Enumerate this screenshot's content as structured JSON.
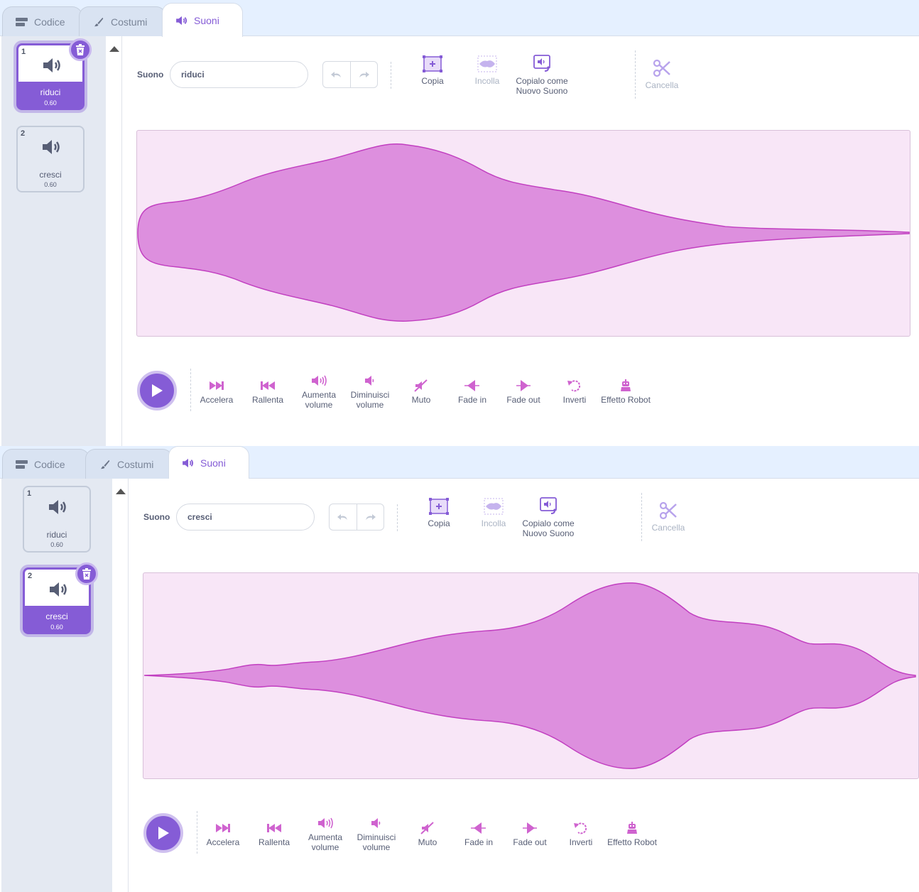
{
  "editors": [
    {
      "tabs": {
        "code": "Codice",
        "costumes": "Costumi",
        "sounds": "Suoni"
      },
      "sound_label": "Suono",
      "sound_name": "riduci",
      "toolbar": {
        "copy": "Copia",
        "paste": "Incolla",
        "copy_new": "Copialo come Nuovo Suono",
        "delete": "Cancella"
      },
      "sounds": [
        {
          "number": "1",
          "name": "riduci",
          "duration": "0.60",
          "selected": true
        },
        {
          "number": "2",
          "name": "cresci",
          "duration": "0.60",
          "selected": false
        }
      ],
      "effects": {
        "faster": "Accelera",
        "slower": "Rallenta",
        "louder": "Aumenta volume",
        "softer": "Diminuisci volume",
        "mute": "Muto",
        "fade_in": "Fade in",
        "fade_out": "Fade out",
        "reverse": "Inverti",
        "robot": "Effetto Robot"
      }
    },
    {
      "tabs": {
        "code": "Codice",
        "costumes": "Costumi",
        "sounds": "Suoni"
      },
      "sound_label": "Suono",
      "sound_name": "cresci",
      "toolbar": {
        "copy": "Copia",
        "paste": "Incolla",
        "copy_new": "Copialo come Nuovo Suono",
        "delete": "Cancella"
      },
      "sounds": [
        {
          "number": "1",
          "name": "riduci",
          "duration": "0.60",
          "selected": false
        },
        {
          "number": "2",
          "name": "cresci",
          "duration": "0.60",
          "selected": true
        }
      ],
      "effects": {
        "faster": "Accelera",
        "slower": "Rallenta",
        "louder": "Aumenta volume",
        "softer": "Diminuisci volume",
        "mute": "Muto",
        "fade_in": "Fade in",
        "fade_out": "Fade out",
        "reverse": "Inverti",
        "robot": "Effetto Robot"
      }
    }
  ],
  "colors": {
    "accent": "#855cd6",
    "waveform_fill": "#dd8fde",
    "waveform_stroke": "#c13fc0",
    "waveform_bg": "#f8e6f7",
    "effect_icon": "#cf63cf"
  }
}
